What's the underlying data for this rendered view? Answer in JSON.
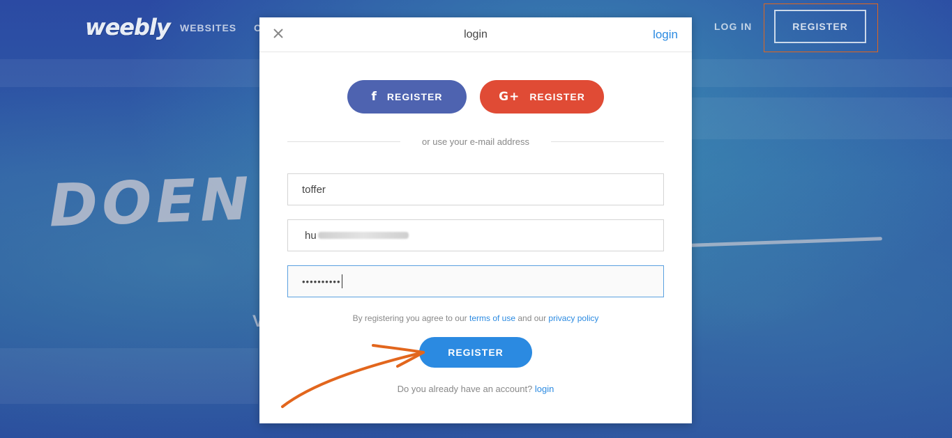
{
  "nav": {
    "logo": "weebly",
    "websites": "WEBSITES",
    "partial": "C",
    "login": "LOG IN",
    "register": "REGISTER"
  },
  "hero": {
    "headline": "DOEN WA                           N HEBT",
    "subline_partial": "V"
  },
  "modal": {
    "close_icon": "close-icon",
    "title": "login",
    "login_link": "login",
    "facebook_register": "REGISTER",
    "google_register": "REGISTER",
    "facebook_icon": "f",
    "google_icon": "G+",
    "divider_text": "or use your e-mail address",
    "username_value": "toffer",
    "email_value": "hu",
    "password_value": "••••••••••",
    "terms_prefix": "By registering you agree to our ",
    "terms_link": "terms of use",
    "terms_mid": " and our ",
    "privacy_link": "privacy policy",
    "register_button": "REGISTER",
    "account_prompt": "Do you already have an account? ",
    "account_login_link": "login"
  },
  "colors": {
    "accent_blue": "#2b8ae1",
    "facebook": "#4e63b0",
    "google": "#e04b35",
    "annotation_orange": "#e2661d"
  }
}
